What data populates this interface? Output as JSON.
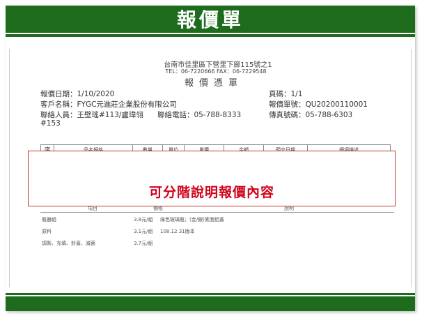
{
  "slide": {
    "title": "報價單",
    "highlight_text": "可分階說明報價內容"
  },
  "header": {
    "address": "台南市佳里區下營里下廍115號之1",
    "tel_fax": "TEL：06-7220666  FAX：06-7229548",
    "doc_title": "報價憑單"
  },
  "info": {
    "date": "報價日期：1/10/2020",
    "page": "頁碼：1/1",
    "customer": "客戶名稱：FYGC元進莊企業股份有限公司",
    "quote_no": "報價單號：QU20200110001",
    "contact": "聯絡人員：王壁瑤#113/盧瑋翎",
    "contact_ext": "#153",
    "phone": "聯絡電話：05-788-8333",
    "fax": "傳真號碼：05-788-6303"
  },
  "table": {
    "headers": [
      "序",
      "品名規格",
      "數量",
      "單位",
      "單價",
      "金額",
      "預交日期",
      "細項描述"
    ]
  },
  "lower": {
    "col_item": "項目",
    "col_price": "價格",
    "col_desc": "說明",
    "rows": [
      {
        "item": "瓶器組",
        "price": "3.8元/組",
        "desc": "綠色玻璃瓶；(金/銀)素面鋁蓋"
      },
      {
        "item": "原料",
        "price": "3.1元/組",
        "desc": "108.12.31版本"
      },
      {
        "item": "調製、充填、封蓋、滅菌",
        "price": "3.7元/組",
        "desc": ""
      }
    ]
  }
}
